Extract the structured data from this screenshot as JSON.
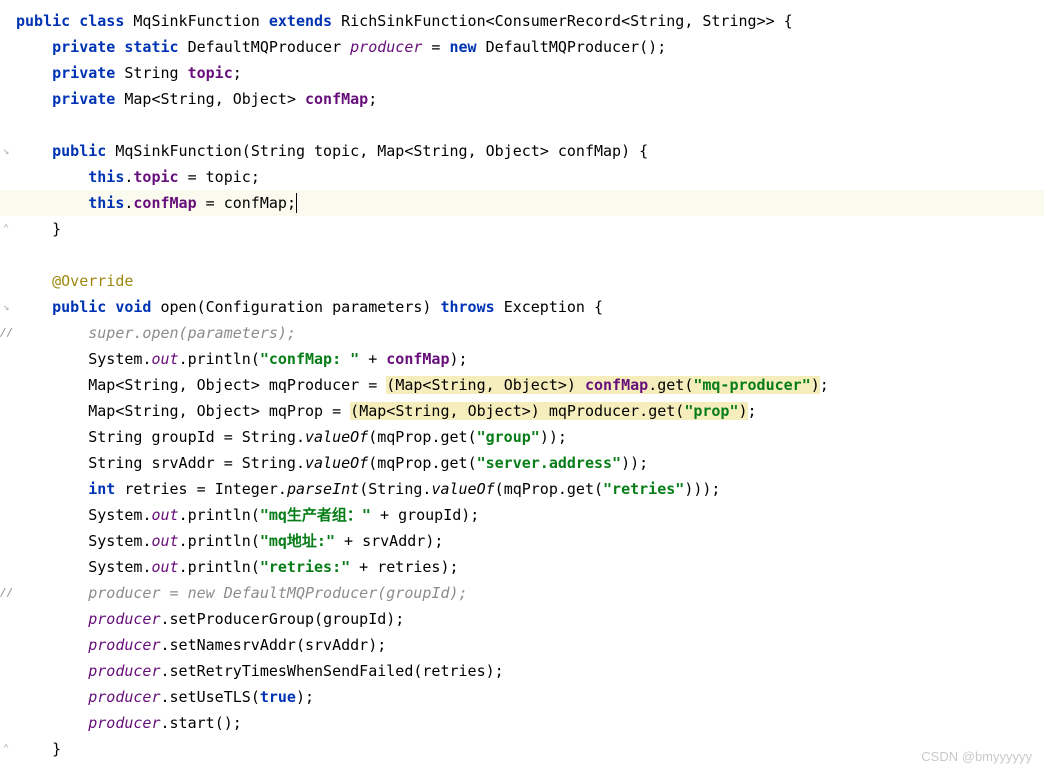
{
  "code": {
    "kw_public": "public",
    "kw_class": "class",
    "kw_extends": "extends",
    "kw_private": "private",
    "kw_static": "static",
    "kw_new": "new",
    "kw_this": "this",
    "kw_void": "void",
    "kw_throws": "throws",
    "kw_int": "int",
    "kw_true": "true",
    "class_name": "MqSinkFunction",
    "super_class": "RichSinkFunction",
    "type_consumer": "ConsumerRecord",
    "type_string": "String",
    "type_map": "Map",
    "type_object": "Object",
    "type_defaultmq": "DefaultMQProducer",
    "type_config": "Configuration",
    "type_exception": "Exception",
    "type_integer": "Integer",
    "type_system": "System",
    "fld_producer": "producer",
    "fld_topic": "topic",
    "fld_confMap": "confMap",
    "fld_out": "out",
    "param_topic": "topic",
    "param_confMap": "confMap",
    "param_parameters": "parameters",
    "var_mqProducer": "mqProducer",
    "var_mqProp": "mqProp",
    "var_groupId": "groupId",
    "var_srvAddr": "srvAddr",
    "var_retries": "retries",
    "mth_open": "open",
    "mth_println": "println",
    "mth_get": "get",
    "mth_valueOf": "valueOf",
    "mth_parseInt": "parseInt",
    "mth_setProducerGroup": "setProducerGroup",
    "mth_setNamesrvAddr": "setNamesrvAddr",
    "mth_setRetry": "setRetryTimesWhenSendFailed",
    "mth_setUseTLS": "setUseTLS",
    "mth_start": "start",
    "ann_override": "@Override",
    "cmt_super": "super.open(parameters);",
    "cmt_producer": "producer = new DefaultMQProducer(groupId);",
    "str_confmap": "\"confMap: \"",
    "str_mqproducer": "\"mq-producer\"",
    "str_prop": "\"prop\"",
    "str_group": "\"group\"",
    "str_serveraddr": "\"server.address\"",
    "str_retries_k": "\"retries\"",
    "str_mq_group": "\"mq生产者组：\"",
    "str_mq_addr": "\"mq地址:\"",
    "str_retries_lbl": "\"retries:\""
  },
  "gutter": {
    "fold_open": "⌄",
    "fold_close": "⌃",
    "arrow": "↘"
  },
  "watermark": "CSDN @bmyyyyyy"
}
